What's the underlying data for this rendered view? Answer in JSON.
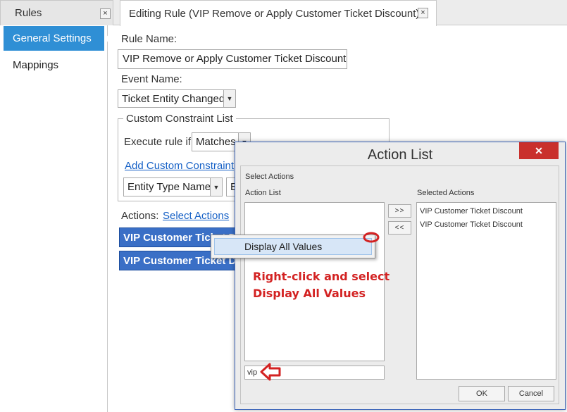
{
  "tabs": {
    "rules": {
      "label": "Rules",
      "close": "×"
    },
    "editing": {
      "label": "Editing Rule (VIP Remove or Apply Customer Ticket Discount)",
      "close": "×"
    }
  },
  "sidebar": {
    "items": [
      {
        "label": "General Settings",
        "active": true
      },
      {
        "label": "Mappings",
        "active": false
      }
    ]
  },
  "form": {
    "rule_name_label": "Rule Name:",
    "rule_name_value": "VIP Remove or Apply Customer Ticket Discount",
    "event_name_label": "Event Name:",
    "event_name_value": "Ticket Entity Changed",
    "constraint_legend": "Custom Constraint List",
    "execute_label": "Execute rule if",
    "execute_value": "Matches",
    "add_constraint_link": "Add Custom Constraint",
    "entity_type_value": "Entity Type Name",
    "second_combo_value": "E",
    "actions_label": "Actions:",
    "select_actions_link": "Select Actions",
    "action_rows": [
      "VIP Customer Ticket Discount",
      "VIP Customer Ticket Discount"
    ]
  },
  "dialog": {
    "title": "Action List",
    "close": "✕",
    "group_label": "Select Actions",
    "action_list_label": "Action List",
    "selected_label": "Selected Actions",
    "selected_items": [
      "VIP Customer Ticket Discount",
      "VIP Customer Ticket Discount"
    ],
    "add_btn": ">>",
    "remove_btn": "<<",
    "filter_value": "vip",
    "ok": "OK",
    "cancel": "Cancel"
  },
  "context_menu": {
    "item": "Display All Values"
  },
  "annotation": {
    "line1": "Right-click and select",
    "line2": "Display All Values"
  },
  "colors": {
    "accent": "#2f8fd5",
    "action_row": "#3a6fc6",
    "annotation": "#d32222",
    "dialog_close": "#c9302c"
  }
}
